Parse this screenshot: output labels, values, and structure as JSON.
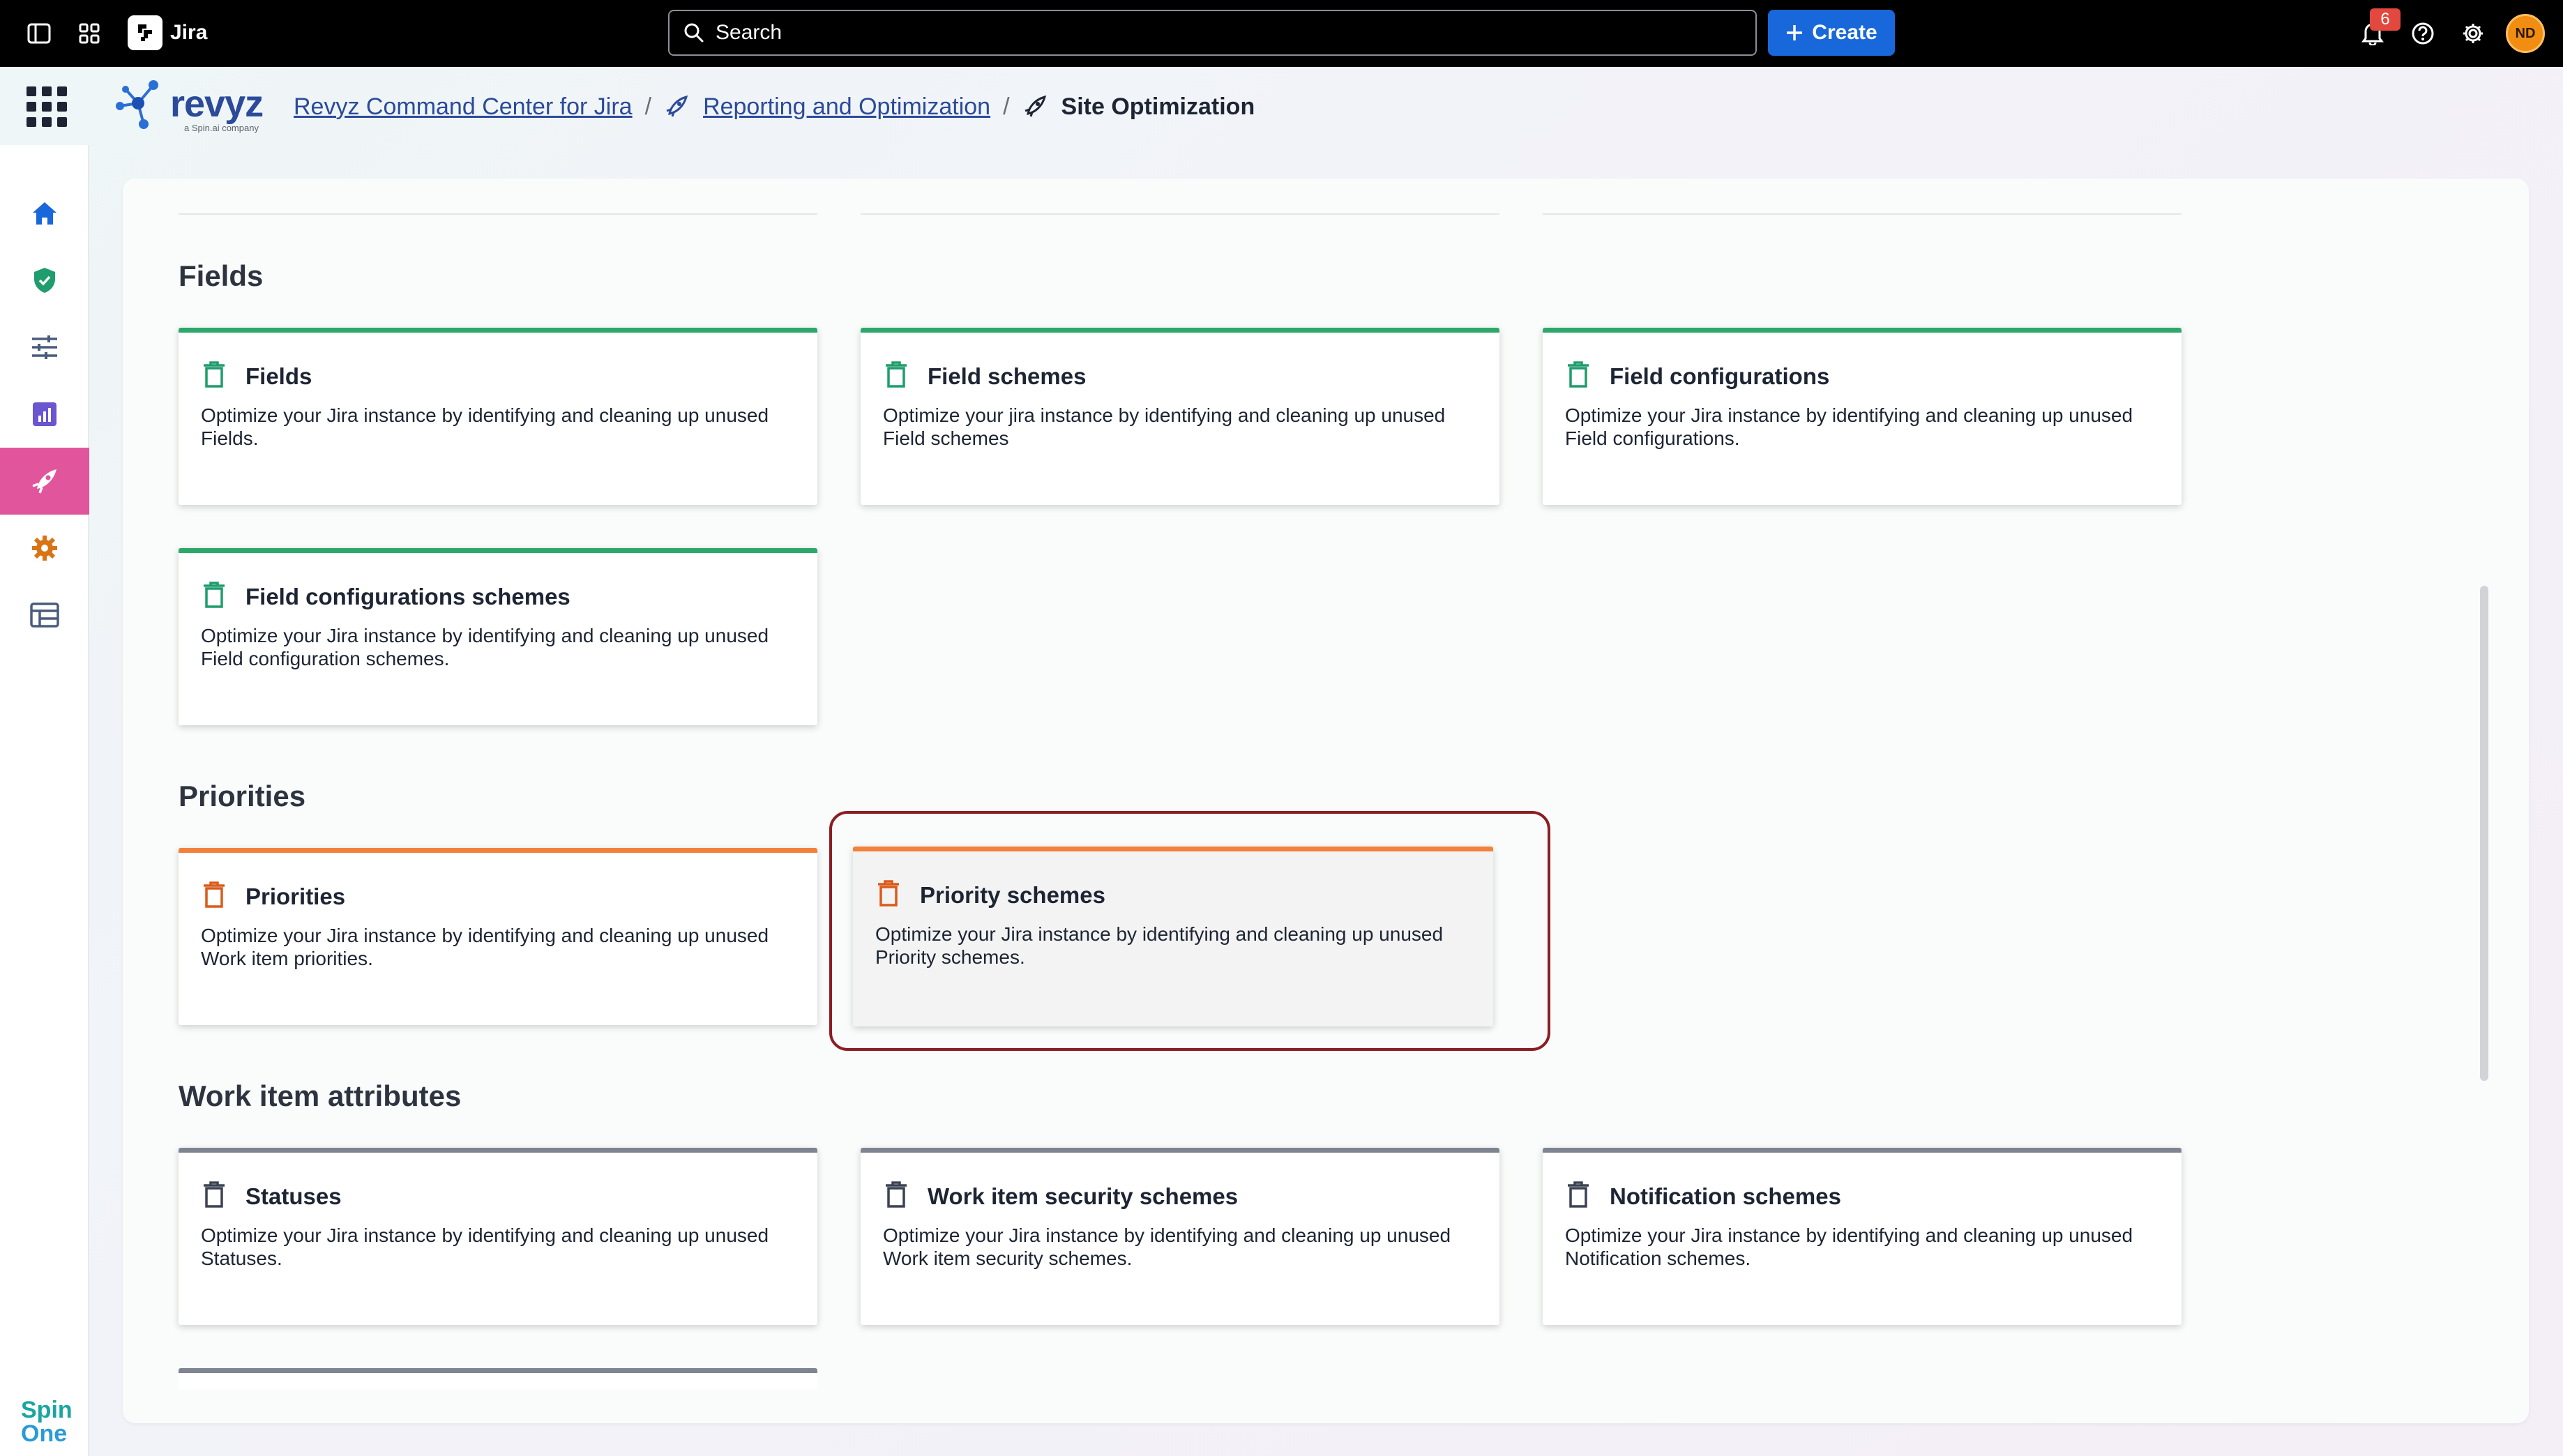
{
  "topbar": {
    "app_name": "Jira",
    "search_placeholder": "Search",
    "create_label": "Create",
    "notification_count": "6",
    "avatar_initials": "ND"
  },
  "breadcrumb": {
    "logo_text": "revyz",
    "logo_subtext": "a Spin.ai company",
    "items": [
      {
        "label": "Revyz Command Center for Jira"
      },
      {
        "label": "Reporting and Optimization"
      },
      {
        "label": "Site Optimization"
      }
    ]
  },
  "sidebar": {
    "items": [
      {
        "icon": "home-icon"
      },
      {
        "icon": "shield-check-icon"
      },
      {
        "icon": "sliders-icon"
      },
      {
        "icon": "report-chart-icon"
      },
      {
        "icon": "rocket-icon",
        "active": true
      },
      {
        "icon": "gear-icon"
      },
      {
        "icon": "table-layout-icon"
      }
    ],
    "footer_logo_line1": "Spin",
    "footer_logo_line2": "One"
  },
  "sections": [
    {
      "title": "Fields",
      "accent": "#2ea86a",
      "cards": [
        {
          "title": "Fields",
          "description": "Optimize your Jira instance by identifying and cleaning up unused Fields."
        },
        {
          "title": "Field schemes",
          "description": "Optimize your jira instance by identifying and cleaning up unused Field schemes"
        },
        {
          "title": "Field configurations",
          "description": "Optimize your Jira instance by identifying and cleaning up unused Field configurations."
        },
        {
          "title": "Field configurations schemes",
          "description": "Optimize your Jira instance by identifying and cleaning up unused Field configuration schemes."
        }
      ]
    },
    {
      "title": "Priorities",
      "accent": "#f2813a",
      "cards": [
        {
          "title": "Priorities",
          "description": "Optimize your Jira instance by identifying and cleaning up unused Work item priorities."
        },
        {
          "title": "Priority schemes",
          "description": "Optimize your Jira instance by identifying and cleaning up unused Priority schemes.",
          "highlighted": true
        }
      ]
    },
    {
      "title": "Work item attributes",
      "accent": "#7f8492",
      "cards": [
        {
          "title": "Statuses",
          "description": "Optimize your Jira instance by identifying and cleaning up unused Statuses."
        },
        {
          "title": "Work item security schemes",
          "description": "Optimize your Jira instance by identifying and cleaning up unused Work item security schemes."
        },
        {
          "title": "Notification schemes",
          "description": "Optimize your Jira instance by identifying and cleaning up unused Notification schemes."
        }
      ]
    }
  ],
  "colors": {
    "highlight_border": "#8b1e24",
    "create_button": "#1868db",
    "active_nav": "#e0559b"
  }
}
